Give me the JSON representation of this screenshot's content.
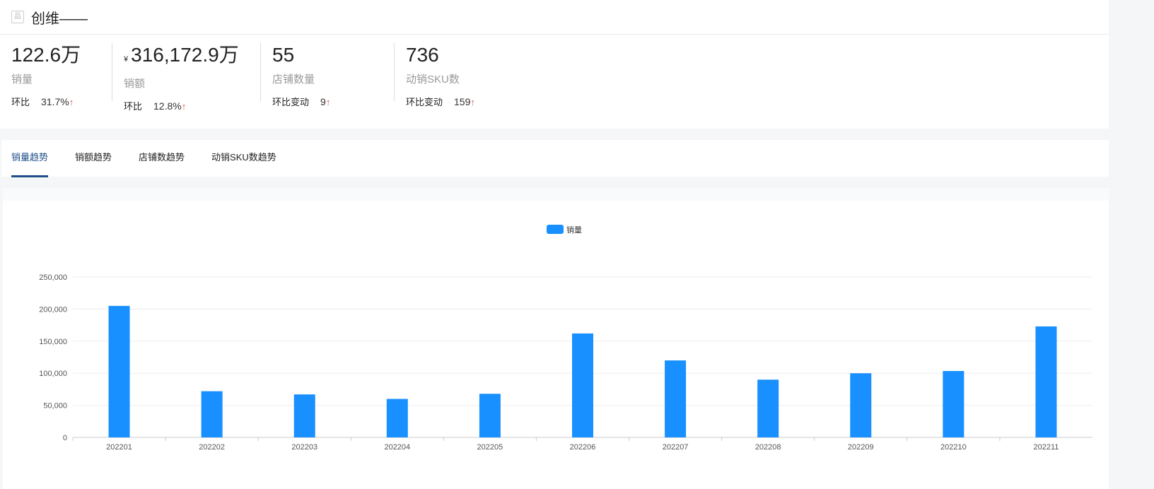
{
  "header": {
    "title": "创维——",
    "icon": "product-icon"
  },
  "stats": [
    {
      "value": "122.6万",
      "prefix": "",
      "label": "销量",
      "change_label": "环比",
      "change": "31.7%"
    },
    {
      "value": "316,172.9万",
      "prefix": "¥",
      "label": "销额",
      "change_label": "环比",
      "change": "12.8%"
    },
    {
      "value": "55",
      "prefix": "",
      "label": "店铺数量",
      "change_label": "环比变动",
      "change": "9"
    },
    {
      "value": "736",
      "prefix": "",
      "label": "动销SKU数",
      "change_label": "环比变动",
      "change": "159"
    }
  ],
  "arrow": "↑",
  "tabs": [
    "销量趋势",
    "销额趋势",
    "店铺数趋势",
    "动销SKU数趋势"
  ],
  "chart_data": {
    "type": "bar",
    "legend": "销量",
    "legend_position": "top-center",
    "color": "#1890ff",
    "categories": [
      "202201",
      "202202",
      "202203",
      "202204",
      "202205",
      "202206",
      "202207",
      "202208",
      "202209",
      "202210",
      "202211"
    ],
    "values": [
      205000,
      72000,
      67000,
      60000,
      68000,
      162000,
      120000,
      90000,
      100000,
      103500,
      173000
    ],
    "ylim": [
      0,
      250000
    ],
    "yticks": [
      "0",
      "50,000",
      "100,000",
      "150,000",
      "200,000",
      "250,000"
    ],
    "grid": true
  }
}
